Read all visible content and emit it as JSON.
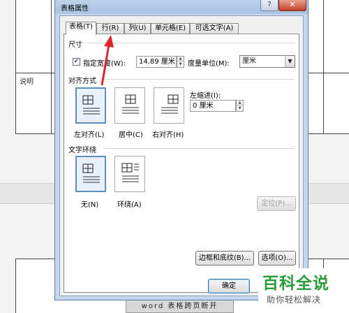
{
  "background": {
    "cell_label": "说明",
    "bottom_cell_text": "word 表格跨页断开"
  },
  "dialog": {
    "title": "表格属性",
    "help_glyph": "?",
    "close_glyph": "✕"
  },
  "tabs": [
    {
      "label": "表格(T)"
    },
    {
      "label": "行(R)"
    },
    {
      "label": "列(U)"
    },
    {
      "label": "单元格(E)"
    },
    {
      "label": "可选文字(A)"
    }
  ],
  "size_section": {
    "label": "尺寸",
    "preferred_width_label": "指定宽度(W):",
    "preferred_width_checked": true,
    "preferred_width_value": "14.89 厘米",
    "unit_label": "度量单位(M):",
    "unit_value": "厘米"
  },
  "alignment_section": {
    "label": "对齐方式",
    "options": [
      {
        "label": "左对齐(L)",
        "selected": true
      },
      {
        "label": "居中(C)",
        "selected": false
      },
      {
        "label": "右对齐(H)",
        "selected": false
      }
    ],
    "indent_label": "左缩进(I):",
    "indent_value": "0 厘米"
  },
  "wrap_section": {
    "label": "文字环绕",
    "options": [
      {
        "label": "无(N)",
        "selected": true
      },
      {
        "label": "环绕(A)",
        "selected": false
      }
    ],
    "position_button": "定位(P)..."
  },
  "buttons": {
    "borders_shading": "边框和底纹(B)...",
    "options": "选项(O)...",
    "ok": "确定"
  },
  "watermark": {
    "title": "百科全说",
    "subtitle": "助你轻松解决"
  },
  "colors": {
    "accent": "#5a8fc7",
    "annotation_arrow": "#d9262b",
    "watermark_green": "#2a9a3a"
  }
}
